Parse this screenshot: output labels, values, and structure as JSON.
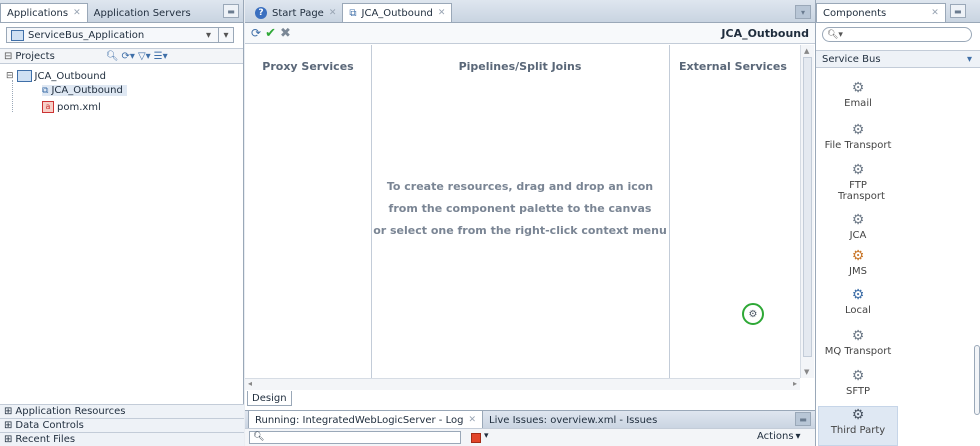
{
  "left": {
    "tabs": [
      "Applications",
      "Application Servers"
    ],
    "app_selector": "ServiceBus_Application",
    "projects_label": "Projects",
    "tree": [
      {
        "label": "JCA_Outbound",
        "level": 1
      },
      {
        "label": "JCA_Outbound",
        "level": 2
      },
      {
        "label": "pom.xml",
        "level": 2
      }
    ],
    "accordions": [
      "Application Resources",
      "Data Controls",
      "Recent Files"
    ]
  },
  "center": {
    "tabs": [
      "Start Page",
      "JCA_Outbound"
    ],
    "title": "JCA_Outbound",
    "columns": [
      "Proxy Services",
      "Pipelines/Split Joins",
      "External Services"
    ],
    "hint_lines": [
      "To create resources, drag and drop an icon",
      "from the component palette to the canvas",
      "or select one from the right-click context menu"
    ],
    "design_tab": "Design",
    "log_tabs": [
      "Running: IntegratedWebLogicServer - Log",
      "Live Issues: overview.xml - Issues"
    ],
    "actions_label": "Actions"
  },
  "right": {
    "header": "Components",
    "category": "Service Bus",
    "components": [
      "Email",
      "File Transport",
      "FTP Transport",
      "JCA",
      "JMS",
      "Local",
      "MQ Transport",
      "SFTP",
      "Third Party"
    ]
  },
  "colors": {
    "accent_green": "#2ea836",
    "panel_border": "#9aa8b8"
  }
}
